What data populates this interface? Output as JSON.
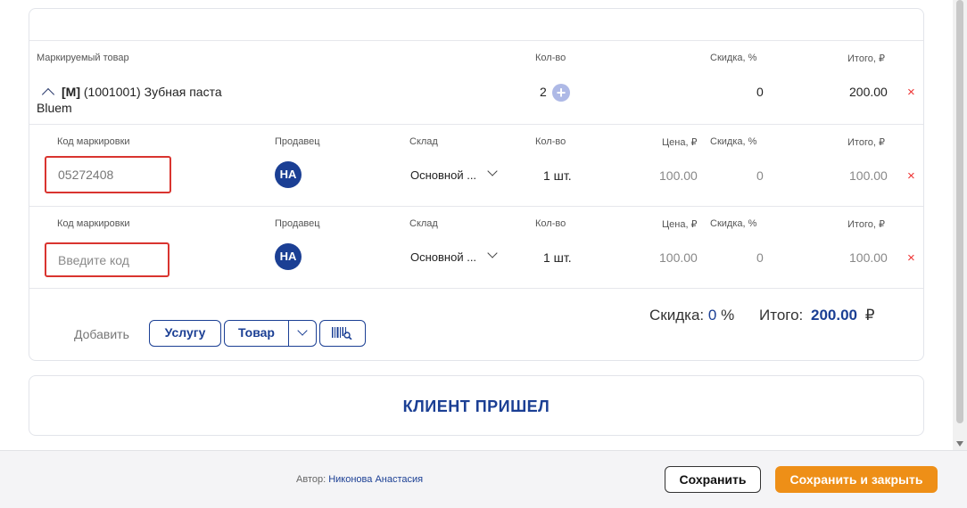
{
  "table": {
    "headers": {
      "product": "Маркируемый товар",
      "qty": "Кол-во",
      "discount": "Скидка, %",
      "total": "Итого, ₽"
    },
    "product_row": {
      "brand_tag": "[M]",
      "name_line1": "(1001001) Зубная паста",
      "name_line2": "Bluem",
      "qty": "2",
      "discount": "0",
      "total": "200.00"
    },
    "sub_headers": {
      "code": "Код маркировки",
      "seller": "Продавец",
      "warehouse": "Склад",
      "qty": "Кол-во",
      "price": "Цена, ₽",
      "discount": "Скидка, %",
      "total": "Итого, ₽"
    },
    "sub_rows": [
      {
        "code_value": "05272408",
        "code_placeholder": "Введите код",
        "seller_initials": "НА",
        "warehouse": "Основной ...",
        "qty": "1 шт.",
        "price": "100.00",
        "discount": "0",
        "total": "100.00"
      },
      {
        "code_value": "",
        "code_placeholder": "Введите код",
        "seller_initials": "НА",
        "warehouse": "Основной ...",
        "qty": "1 шт.",
        "price": "100.00",
        "discount": "0",
        "total": "100.00"
      }
    ],
    "delete_symbol": "×"
  },
  "summary": {
    "discount_label": "Скидка:",
    "discount_value": "0",
    "discount_unit": "%",
    "total_label": "Итого:",
    "total_value": "200.00",
    "currency": "₽"
  },
  "add": {
    "label": "Добавить",
    "service_button": "Услугу",
    "product_button": "Товар"
  },
  "client_button": "КЛИЕНТ ПРИШЕЛ",
  "footer": {
    "author_label": "Автор:",
    "author_name": "Никонова Анастасия",
    "save_button": "Сохранить",
    "save_close_button": "Сохранить и закрыть"
  },
  "colors": {
    "accent_blue": "#1b3f94",
    "orange": "#ee8f17",
    "error_red": "#d9342f"
  },
  "icons": {
    "expand": "chevron-up-icon",
    "add_qty": "plus-circle-icon",
    "delete": "close-icon",
    "dropdown": "chevron-down-icon",
    "scan": "barcode-scan-icon"
  }
}
